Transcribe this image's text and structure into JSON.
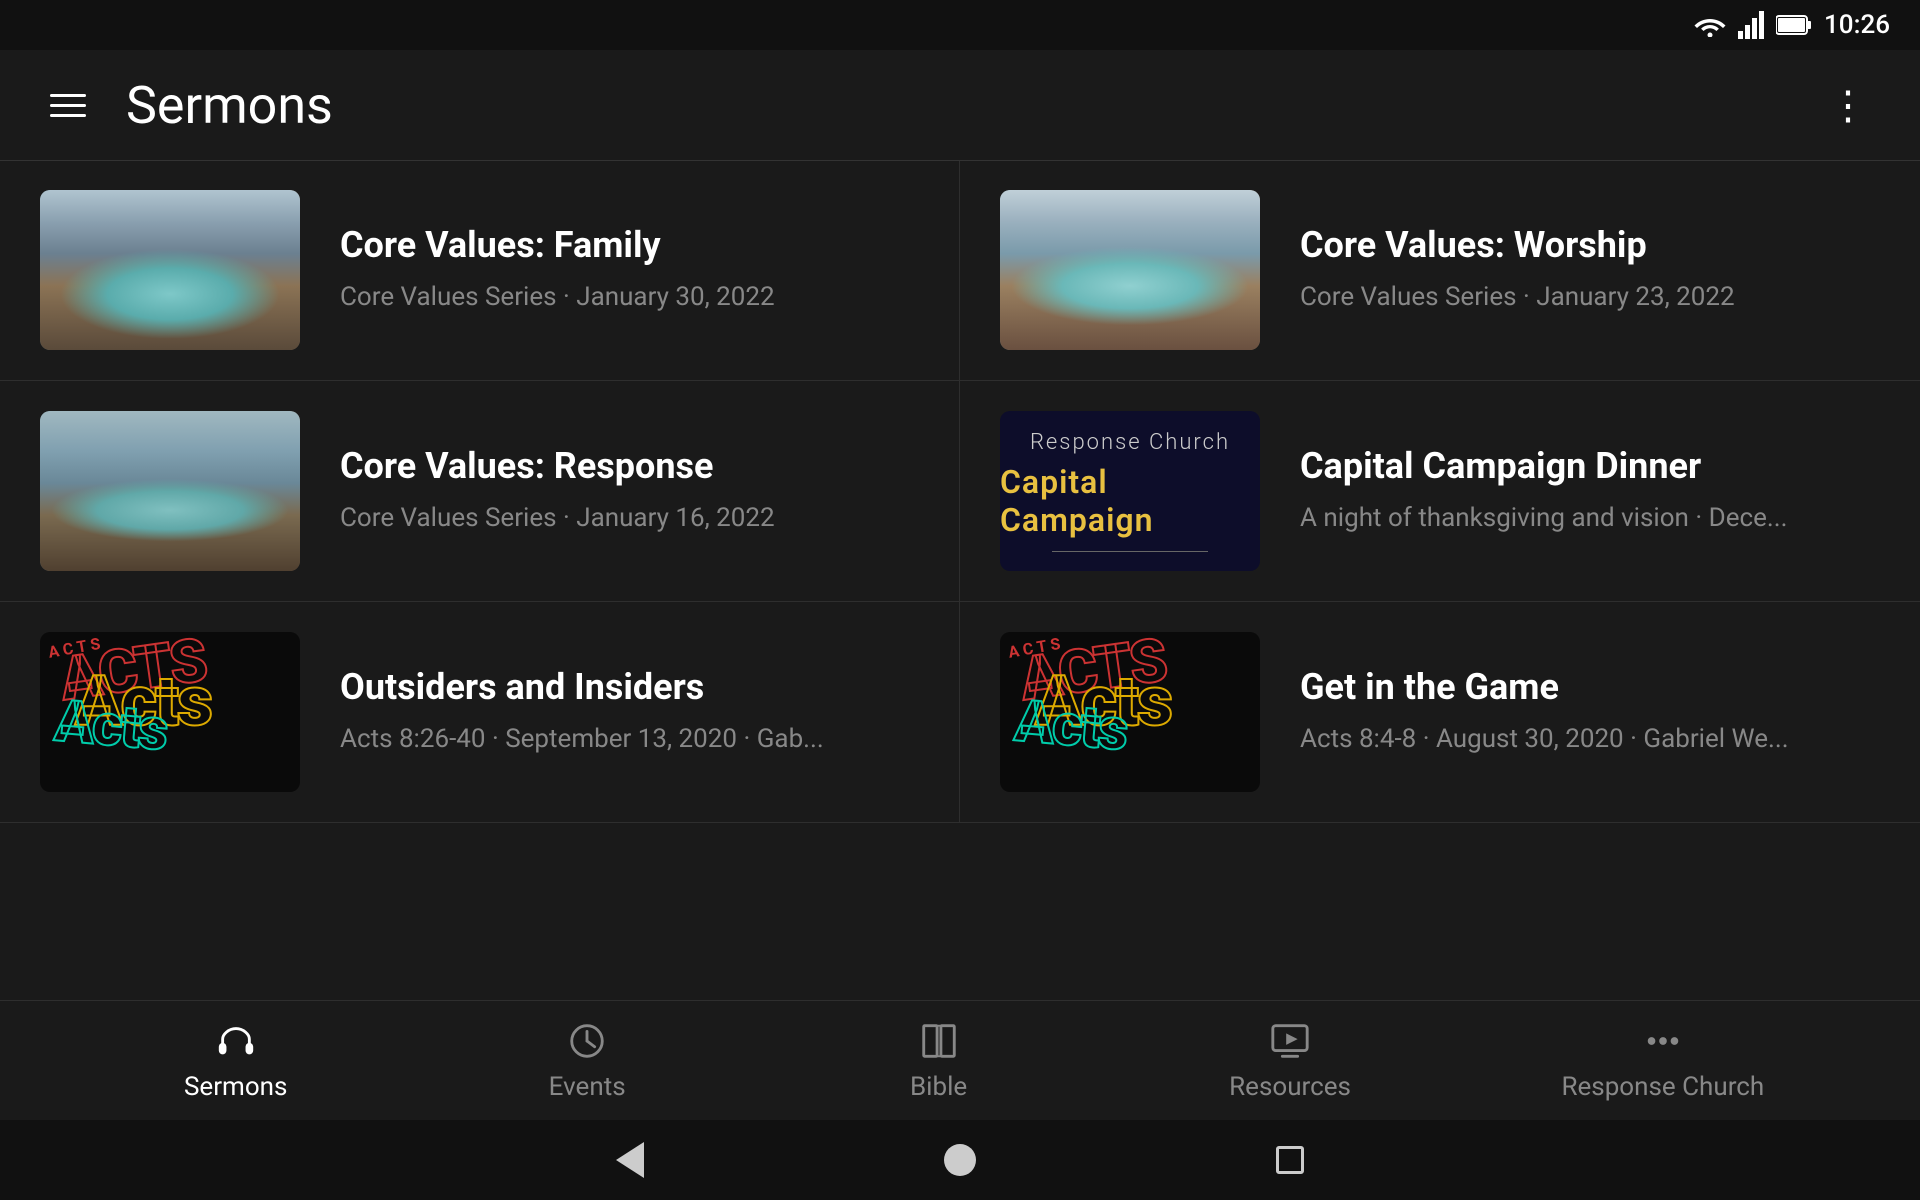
{
  "statusBar": {
    "time": "10:26",
    "icons": [
      "wifi",
      "signal",
      "battery"
    ]
  },
  "header": {
    "title": "Sermons",
    "menuLabel": "Menu",
    "moreLabel": "More options"
  },
  "sermons": [
    {
      "id": 1,
      "title": "Core Values: Family",
      "series": "Core Values Series",
      "date": "January 30, 2022",
      "thumbnail": "lake1"
    },
    {
      "id": 2,
      "title": "Core Values: Worship",
      "series": "Core Values Series",
      "date": "January 23, 2022",
      "thumbnail": "lake2"
    },
    {
      "id": 3,
      "title": "Core Values: Response",
      "series": "Core Values Series",
      "date": "January 16, 2022",
      "thumbnail": "lake3"
    },
    {
      "id": 4,
      "title": "Capital Campaign Dinner",
      "series": "A night of thanksgiving and vision",
      "date": "Dece...",
      "thumbnail": "capital"
    },
    {
      "id": 5,
      "title": "Outsiders and Insiders",
      "series": "Acts 8:26-40",
      "date": "September 13, 2020",
      "speaker": "Gab...",
      "thumbnail": "acts"
    },
    {
      "id": 6,
      "title": "Get in the Game",
      "series": "Acts 8:4-8",
      "date": "August 30, 2020",
      "speaker": "Gabriel We...",
      "thumbnail": "acts"
    }
  ],
  "capitalCampaign": {
    "churchName": "Response Church",
    "campaignLabel": "Capital Campaign"
  },
  "actsLabel": "Acts",
  "bottomNav": {
    "items": [
      {
        "id": "sermons",
        "label": "Sermons",
        "active": true
      },
      {
        "id": "events",
        "label": "Events",
        "active": false
      },
      {
        "id": "bible",
        "label": "Bible",
        "active": false
      },
      {
        "id": "resources",
        "label": "Resources",
        "active": false
      },
      {
        "id": "response",
        "label": "Response Church",
        "active": false
      }
    ]
  }
}
